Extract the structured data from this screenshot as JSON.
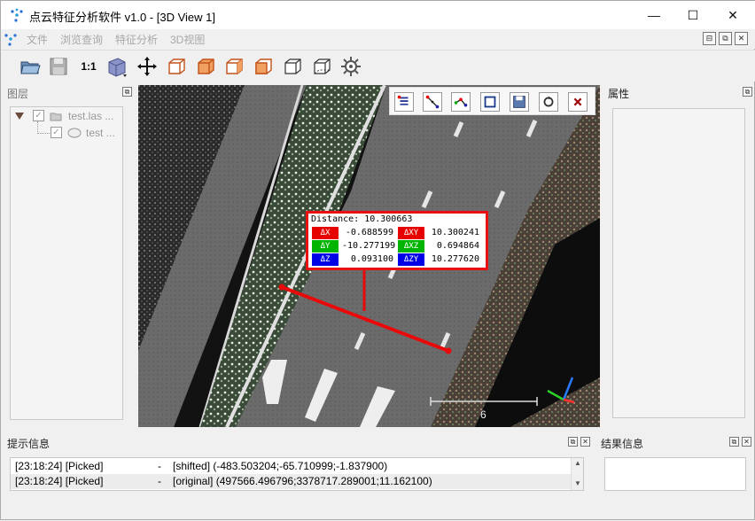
{
  "window": {
    "title": "点云特征分析软件 v1.0 - [3D View 1]",
    "minimize": "—",
    "maximize": "☐",
    "close": "✕"
  },
  "menu": {
    "items": [
      "文件",
      "浏览查询",
      "特征分析",
      "3D视图"
    ],
    "mdi": [
      "⊟",
      "⧉",
      "✕"
    ]
  },
  "toolbar": {
    "zoom_label": "1:1",
    "icons": [
      "open-folder-icon",
      "save-icon",
      "one-to-one-icon",
      "cube-view-icon",
      "move-icon",
      "view-front-icon",
      "view-back-icon",
      "view-left-icon",
      "view-right-icon",
      "view-top-icon",
      "view-bottom-icon",
      "settings-gear-icon"
    ]
  },
  "layers": {
    "title": "图层",
    "tree": [
      {
        "label": "test.las ...",
        "checked": true
      },
      {
        "label": "test ...",
        "checked": true
      }
    ]
  },
  "properties": {
    "title": "属性"
  },
  "view": {
    "tools": [
      "layer-list-icon",
      "point-pick-icon",
      "polyline-icon",
      "measure-icon",
      "save-view-icon",
      "reset-icon",
      "close-icon"
    ],
    "scale_label": "6"
  },
  "measurement": {
    "distance": "Distance: 10.300663",
    "rows": [
      {
        "tag1": "ΔX",
        "v1": "-0.688599",
        "tag2": "ΔXY",
        "v2": "10.300241",
        "c1": "#e60000",
        "c2": "#e60000"
      },
      {
        "tag1": "ΔY",
        "v1": "-10.277199",
        "tag2": "ΔXZ",
        "v2": "0.694864",
        "c1": "#00b400",
        "c2": "#00b400"
      },
      {
        "tag1": "ΔZ",
        "v1": "0.093100",
        "tag2": "ΔZY",
        "v2": "10.277620",
        "c1": "#0000e6",
        "c2": "#0000e6"
      }
    ]
  },
  "log": {
    "title": "提示信息",
    "lines": [
      {
        "time": "[23:18:24] [Picked]",
        "sep": "-",
        "msg": "[shifted] (-483.503204;-65.710999;-1.837900)"
      },
      {
        "time": "[23:18:24] [Picked]",
        "sep": "-",
        "msg": "[original] (497566.496796;3378717.289001;11.162100)"
      }
    ]
  },
  "results": {
    "title": "结果信息"
  }
}
